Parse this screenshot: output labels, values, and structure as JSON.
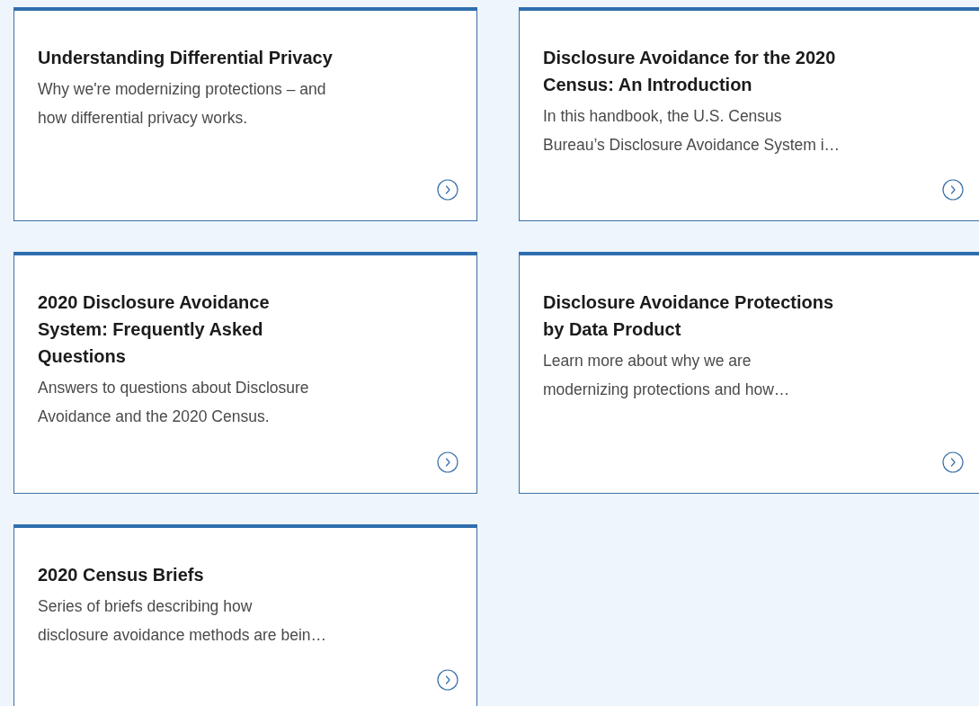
{
  "cards": [
    {
      "title": [
        "Understanding Differential Privacy"
      ],
      "description": [
        "Why we're modernizing protections – and",
        "how differential privacy works."
      ]
    },
    {
      "title": [
        "Disclosure Avoidance for the 2020",
        "Census: An Introduction"
      ],
      "description": [
        "In this handbook, the U.S. Census",
        "Bureau’s Disclosure Avoidance System i…"
      ]
    },
    {
      "title": [
        "2020 Disclosure Avoidance",
        "System: Frequently Asked",
        "Questions"
      ],
      "description": [
        "Answers to questions about Disclosure",
        "Avoidance and the 2020 Census."
      ]
    },
    {
      "title": [
        "Disclosure Avoidance Protections",
        "by Data Product"
      ],
      "description": [
        "Learn more about why we are",
        "modernizing protections and how…"
      ]
    },
    {
      "title": [
        "2020 Census Briefs"
      ],
      "description": [
        "Series of briefs describing how",
        "disclosure avoidance methods are bein…"
      ]
    }
  ]
}
